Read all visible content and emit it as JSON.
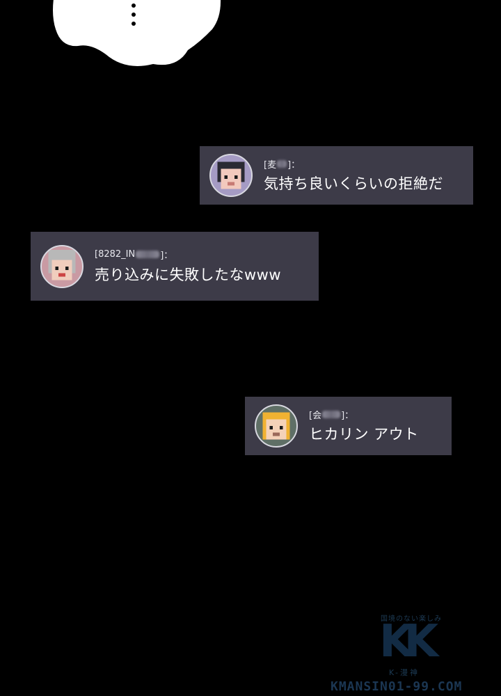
{
  "messages": [
    {
      "name_prefix": "[麦",
      "name_suffix": "]：",
      "text": "気持ち良いくらいの拒絶だ"
    },
    {
      "name_prefix": "[8282_IN",
      "name_suffix": "]：",
      "text": "売り込みに失敗したなwww"
    },
    {
      "name_prefix": "[会",
      "name_suffix": "]：",
      "text": "ヒカリン アウト"
    }
  ],
  "watermark": {
    "tagline": "国境のない楽しみ",
    "logo": "KK",
    "subtitle": "K-漫神",
    "url": "KMANSIN01-99.COM"
  }
}
